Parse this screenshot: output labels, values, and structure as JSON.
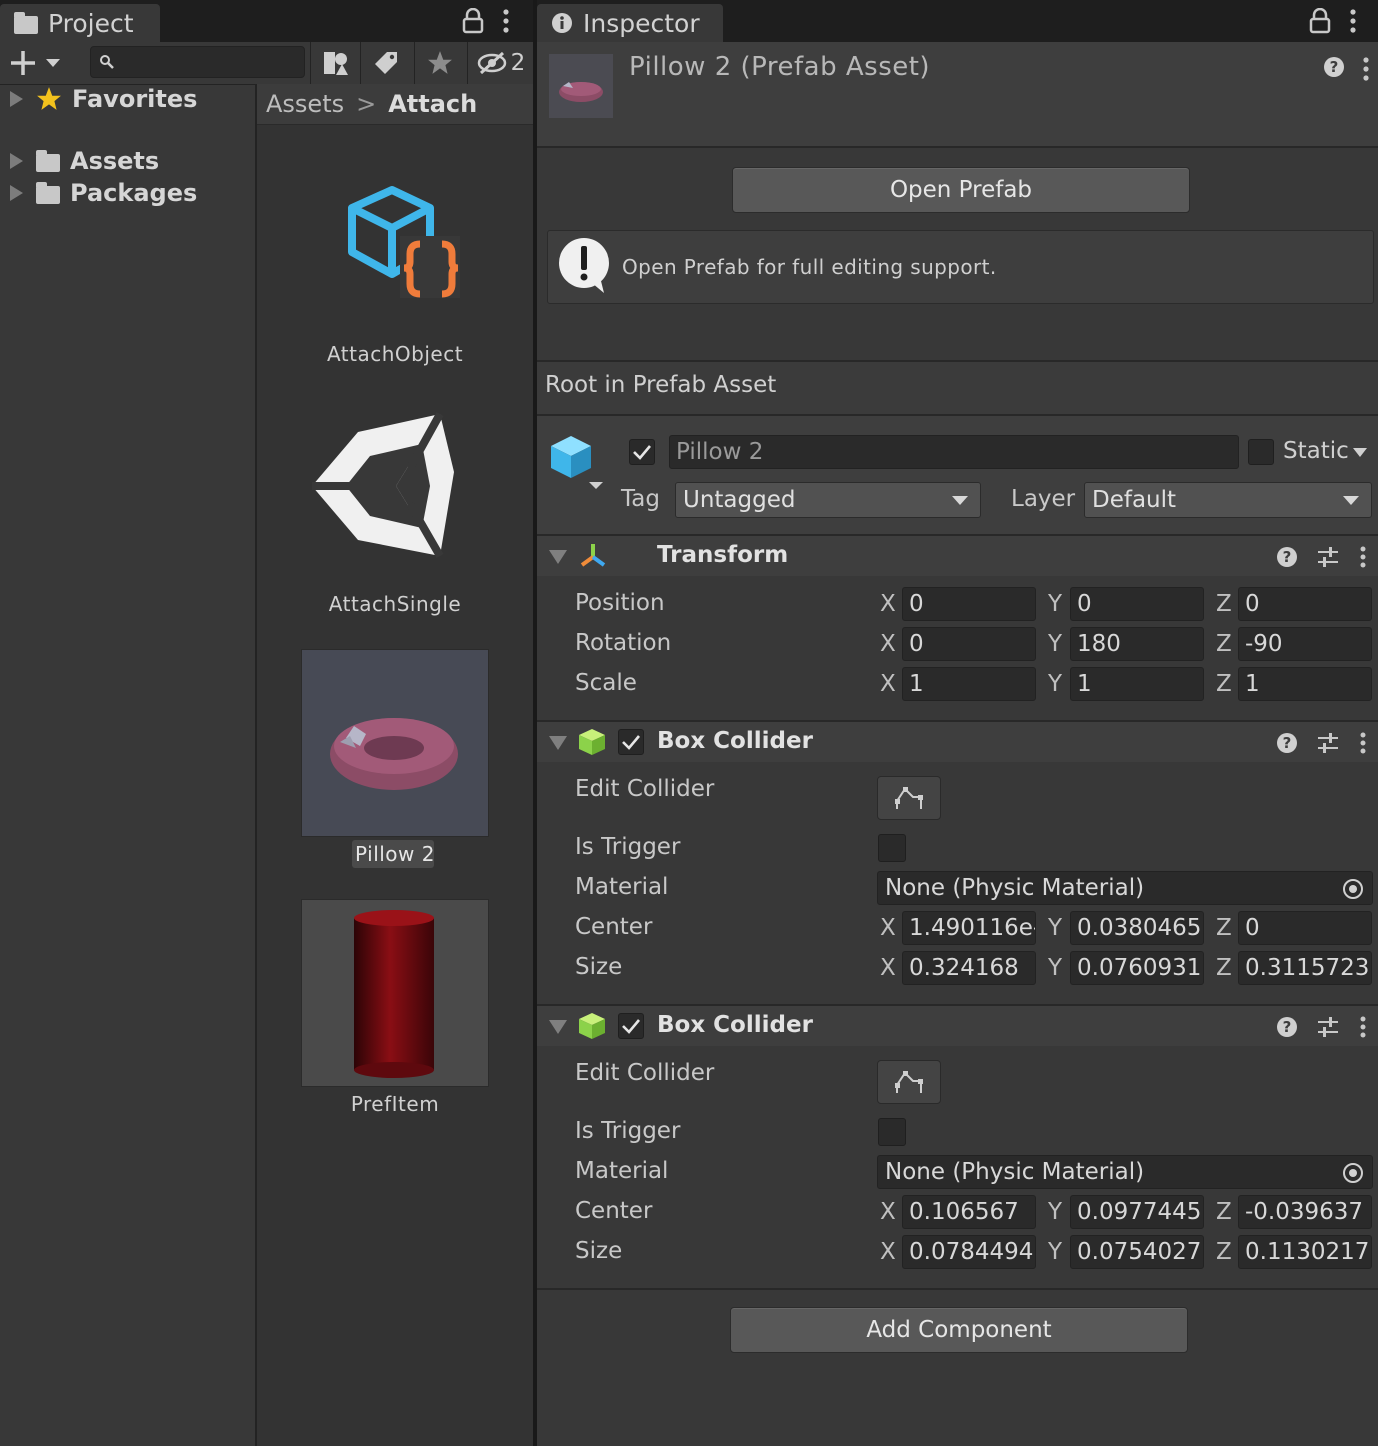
{
  "project": {
    "tab_label": "Project",
    "hidden_count": "2",
    "tree": [
      {
        "label": "Favorites",
        "icon": "star-icon"
      },
      {
        "label": "Assets",
        "icon": "folder-icon"
      },
      {
        "label": "Packages",
        "icon": "folder-icon"
      }
    ],
    "breadcrumb": {
      "root": "Assets",
      "separator": ">",
      "current": "Attach"
    },
    "assets": [
      {
        "label": "AttachObject",
        "icon": "script-cube-icon"
      },
      {
        "label": "AttachSingle",
        "icon": "unity-logo-icon"
      },
      {
        "label": "Pillow 2",
        "icon": "pillow-prefab-thumbnail",
        "selected": true
      },
      {
        "label": "PrefItem",
        "icon": "red-cylinder-thumbnail"
      }
    ]
  },
  "inspector": {
    "tab_label": "Inspector",
    "asset_title": "Pillow 2 (Prefab Asset)",
    "open_prefab_label": "Open Prefab",
    "info_message": "Open Prefab for full editing support.",
    "root_label": "Root in Prefab Asset",
    "gameobject": {
      "active": true,
      "name": "Pillow 2",
      "static_label": "Static",
      "tag_label": "Tag",
      "tag_value": "Untagged",
      "layer_label": "Layer",
      "layer_value": "Default"
    },
    "transform": {
      "title": "Transform",
      "rows": [
        {
          "label": "Position",
          "x": "0",
          "y": "0",
          "z": "0"
        },
        {
          "label": "Rotation",
          "x": "0",
          "y": "180",
          "z": "-90"
        },
        {
          "label": "Scale",
          "x": "1",
          "y": "1",
          "z": "1"
        }
      ]
    },
    "colliders": [
      {
        "title": "Box Collider",
        "enabled": true,
        "edit_label": "Edit Collider",
        "trigger_label": "Is Trigger",
        "material_label": "Material",
        "material_value": "None (Physic Material)",
        "center_label": "Center",
        "center": {
          "x": "1.490116e-",
          "y": "0.0380465",
          "z": "0"
        },
        "size_label": "Size",
        "size": {
          "x": "0.324168",
          "y": "0.0760931",
          "z": "0.3115723"
        }
      },
      {
        "title": "Box Collider",
        "enabled": true,
        "edit_label": "Edit Collider",
        "trigger_label": "Is Trigger",
        "material_label": "Material",
        "material_value": "None (Physic Material)",
        "center_label": "Center",
        "center": {
          "x": "0.106567",
          "y": "0.0977445",
          "z": "-0.039637"
        },
        "size_label": "Size",
        "size": {
          "x": "0.0784494",
          "y": "0.0754027",
          "z": "0.1130217"
        }
      }
    ],
    "add_component_label": "Add Component",
    "axis_labels": {
      "x": "X",
      "y": "Y",
      "z": "Z"
    }
  }
}
